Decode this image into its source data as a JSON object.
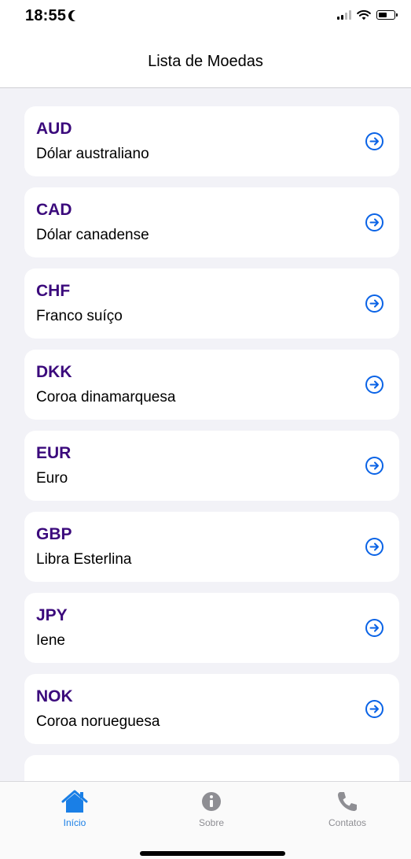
{
  "status_bar": {
    "time": "18:55"
  },
  "header": {
    "title": "Lista de Moedas"
  },
  "currencies": [
    {
      "code": "AUD",
      "name": "Dólar australiano"
    },
    {
      "code": "CAD",
      "name": "Dólar canadense"
    },
    {
      "code": "CHF",
      "name": "Franco suíço"
    },
    {
      "code": "DKK",
      "name": "Coroa dinamarquesa"
    },
    {
      "code": "EUR",
      "name": "Euro"
    },
    {
      "code": "GBP",
      "name": "Libra Esterlina"
    },
    {
      "code": "JPY",
      "name": "Iene"
    },
    {
      "code": "NOK",
      "name": "Coroa norueguesa"
    }
  ],
  "tabs": [
    {
      "label": "Início",
      "icon": "home-icon",
      "active": true
    },
    {
      "label": "Sobre",
      "icon": "info-icon",
      "active": false
    },
    {
      "label": "Contatos",
      "icon": "phone-icon",
      "active": false
    }
  ],
  "colors": {
    "currency_code": "#3b0a7c",
    "accent": "#0a63e6",
    "active_tab": "#1a7fe6",
    "inactive_tab": "#8e8e93",
    "list_background": "#f2f2f7"
  }
}
